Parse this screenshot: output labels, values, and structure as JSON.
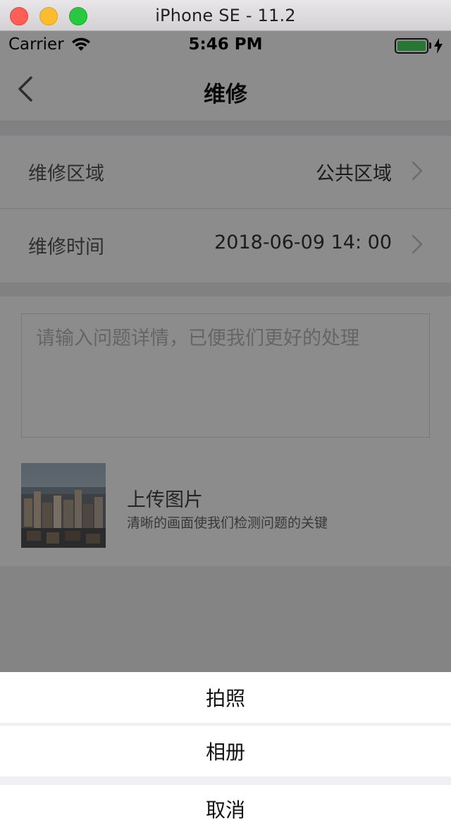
{
  "window": {
    "title": "iPhone SE - 11.2"
  },
  "status_bar": {
    "carrier": "Carrier",
    "time": "5:46 PM"
  },
  "nav": {
    "title": "维修"
  },
  "form": {
    "area": {
      "label": "维修区域",
      "value": "公共区域"
    },
    "time": {
      "label": "维修时间",
      "value": "2018-06-09 14: 00"
    },
    "detail": {
      "placeholder": "请输入问题详情，已便我们更好的处理",
      "value": ""
    },
    "upload": {
      "title": "上传图片",
      "subtitle": "清晰的画面使我们检测问题的关键"
    }
  },
  "action_sheet": {
    "camera": "拍照",
    "album": "相册",
    "cancel": "取消"
  },
  "colors": {
    "accent_battery": "#4cd964",
    "overlay": "rgba(0,0,0,0.45)"
  }
}
